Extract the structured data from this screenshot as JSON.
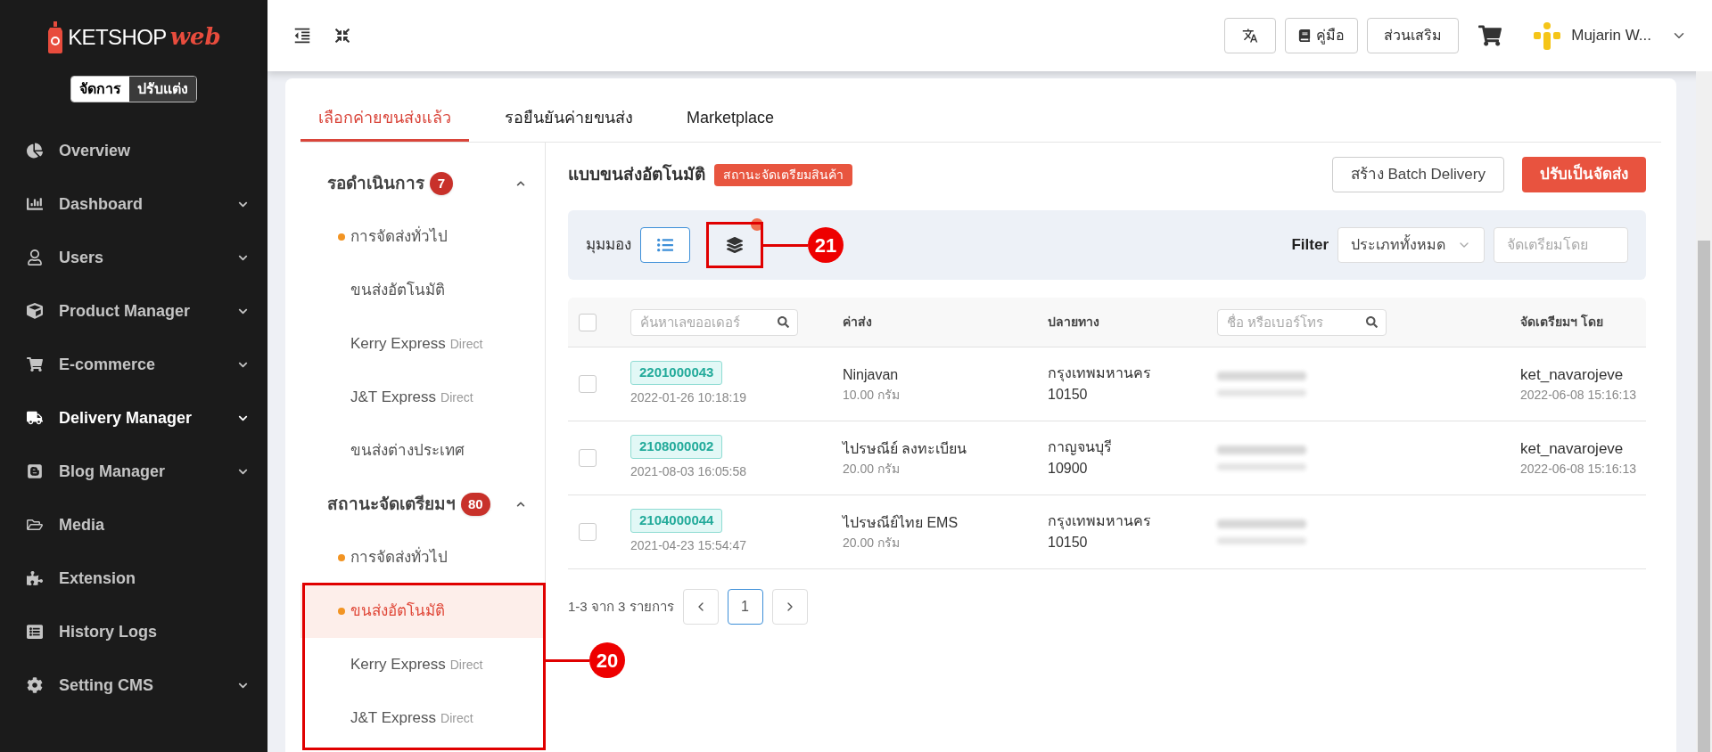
{
  "sidebar": {
    "logo": {
      "brand": "KETSHOP",
      "suffix": "web"
    },
    "mode_toggle": [
      {
        "label": "จัดการ",
        "selected": true
      },
      {
        "label": "ปรับแต่ง",
        "selected": false
      }
    ],
    "items": [
      {
        "label": "Overview",
        "expandable": false,
        "selected": false
      },
      {
        "label": "Dashboard",
        "expandable": true,
        "selected": false
      },
      {
        "label": "Users",
        "expandable": true,
        "selected": false
      },
      {
        "label": "Product Manager",
        "expandable": true,
        "selected": false
      },
      {
        "label": "E-commerce",
        "expandable": true,
        "selected": false
      },
      {
        "label": "Delivery Manager",
        "expandable": true,
        "selected": true
      },
      {
        "label": "Blog Manager",
        "expandable": true,
        "selected": false
      },
      {
        "label": "Media",
        "expandable": false,
        "selected": false
      },
      {
        "label": "Extension",
        "expandable": false,
        "selected": false
      },
      {
        "label": "History Logs",
        "expandable": false,
        "selected": false
      },
      {
        "label": "Setting CMS",
        "expandable": true,
        "selected": false
      }
    ]
  },
  "header": {
    "manual_button": "คู่มือ",
    "addons_button": "ส่วนเสริม",
    "user_name": "Mujarin W..."
  },
  "tabs": [
    {
      "label": "เลือกค่ายขนส่งแล้ว",
      "selected": true
    },
    {
      "label": "รอยืนยันค่ายขนส่ง",
      "selected": false
    },
    {
      "label": "Marketplace",
      "selected": false
    }
  ],
  "subnav": [
    {
      "title": "รอดำเนินการ",
      "count": "7",
      "expanded": true,
      "items": [
        {
          "label": "การจัดส่งทั่วไป",
          "dot": true,
          "selected": false
        },
        {
          "label": "ขนส่งอัตโนมัติ",
          "dot": false,
          "selected": false
        },
        {
          "label": "Kerry Express",
          "suffix": "Direct",
          "dot": false,
          "selected": false
        },
        {
          "label": "J&T Express",
          "suffix": "Direct",
          "dot": false,
          "selected": false
        },
        {
          "label": "ขนส่งต่างประเทศ",
          "dot": false,
          "selected": false
        }
      ]
    },
    {
      "title": "สถานะจัดเตรียมฯ",
      "count": "80",
      "expanded": true,
      "items": [
        {
          "label": "การจัดส่งทั่วไป",
          "dot": true,
          "selected": false
        },
        {
          "label": "ขนส่งอัตโนมัติ",
          "dot": true,
          "selected": true
        },
        {
          "label": "Kerry Express",
          "suffix": "Direct",
          "dot": false,
          "selected": false
        },
        {
          "label": "J&T Express",
          "suffix": "Direct",
          "dot": false,
          "selected": false
        }
      ]
    }
  ],
  "main": {
    "title": "แบบขนส่งอัตโนมัติ",
    "status_badge": "สถานะจัดเตรียมสินค้า",
    "actions": [
      {
        "label": "สร้าง Batch Delivery",
        "kind": "outline"
      },
      {
        "label": "ปรับเป็นจัดส่ง",
        "kind": "primary"
      }
    ],
    "toolbar": {
      "view_label": "มุมมอง",
      "views": [
        {
          "kind": "list",
          "selected": true
        },
        {
          "kind": "layers",
          "selected": false
        }
      ],
      "filter_label": "Filter",
      "type_select": "ประเภททั้งหมด",
      "prepared_by_placeholder": "จัดเตรียมโดย"
    },
    "table": {
      "select_all_checked": false,
      "order_search_placeholder": "ค้นหาเลขออเดอร์",
      "columns": [
        "ค่าส่ง",
        "ปลายทาง"
      ],
      "name_search_placeholder": "ชื่อ หรือเบอร์โทร",
      "last_column": "จัดเตรียมฯ โดย",
      "rows": [
        {
          "checked": false,
          "order_no": "2201000043",
          "created": "2022-01-26 10:18:19",
          "carrier": "Ninjavan",
          "weight": "10.00 กรัม",
          "province": "กรุงเทพมหานคร",
          "postcode": "10150",
          "prepared_by": "ket_navarojeve",
          "prepared_at": "2022-06-08 15:16:13"
        },
        {
          "checked": false,
          "order_no": "2108000002",
          "created": "2021-08-03 16:05:58",
          "carrier": "ไปรษณีย์ ลงทะเบียน",
          "weight": "20.00 กรัม",
          "province": "กาญจนบุรี",
          "postcode": "10900",
          "prepared_by": "ket_navarojeve",
          "prepared_at": "2022-06-08 15:16:13"
        },
        {
          "checked": false,
          "order_no": "2104000044",
          "created": "2021-04-23 15:54:47",
          "carrier": "ไปรษณีย์ไทย EMS",
          "weight": "20.00 กรัม",
          "province": "กรุงเทพมหานคร",
          "postcode": "10150"
        }
      ]
    },
    "pagination": {
      "summary": "1-3 จาก 3 รายการ",
      "pages": [
        {
          "label": "1",
          "selected": true
        }
      ]
    }
  },
  "callouts": [
    {
      "label": "20"
    },
    {
      "label": "21"
    }
  ]
}
